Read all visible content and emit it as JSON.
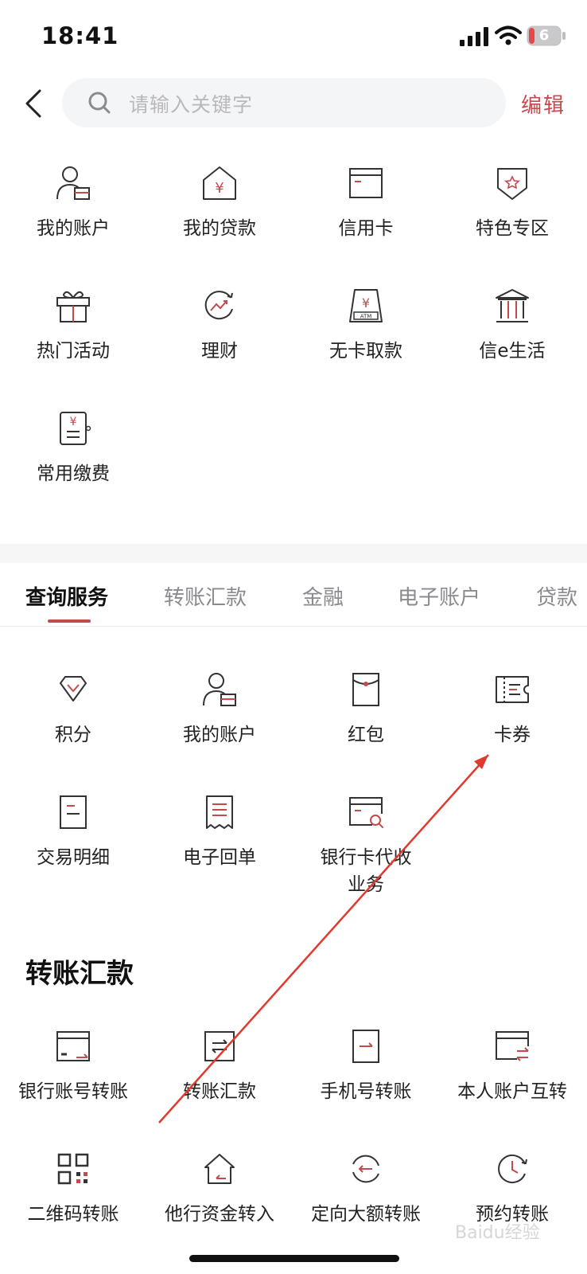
{
  "status": {
    "time": "18:41",
    "battery": "6"
  },
  "header": {
    "search_placeholder": "请输入关键字",
    "edit_label": "编辑"
  },
  "favorites": [
    {
      "label": "我的账户",
      "icon": "account-icon"
    },
    {
      "label": "我的贷款",
      "icon": "loan-icon"
    },
    {
      "label": "信用卡",
      "icon": "credit-card-icon"
    },
    {
      "label": "特色专区",
      "icon": "special-zone-icon"
    },
    {
      "label": "热门活动",
      "icon": "gift-icon"
    },
    {
      "label": "理财",
      "icon": "wealth-icon"
    },
    {
      "label": "无卡取款",
      "icon": "atm-icon"
    },
    {
      "label": "信e生活",
      "icon": "life-icon"
    },
    {
      "label": "常用缴费",
      "icon": "bill-icon"
    }
  ],
  "tabs": [
    "查询服务",
    "转账汇款",
    "金融",
    "电子账户",
    "贷款"
  ],
  "query_services": [
    {
      "label": "积分",
      "icon": "points-icon"
    },
    {
      "label": "我的账户",
      "icon": "account-icon"
    },
    {
      "label": "红包",
      "icon": "red-packet-icon"
    },
    {
      "label": "卡券",
      "icon": "coupon-icon"
    },
    {
      "label": "交易明细",
      "icon": "transaction-detail-icon"
    },
    {
      "label": "电子回单",
      "icon": "receipt-icon"
    },
    {
      "label": "银行卡代收业务",
      "icon": "card-collection-icon"
    }
  ],
  "transfer_section": {
    "title": "转账汇款",
    "items": [
      {
        "label": "银行账号转账",
        "icon": "account-transfer-icon"
      },
      {
        "label": "转账汇款",
        "icon": "remittance-icon"
      },
      {
        "label": "手机号转账",
        "icon": "phone-transfer-icon"
      },
      {
        "label": "本人账户互转",
        "icon": "self-transfer-icon"
      },
      {
        "label": "二维码转账",
        "icon": "qrcode-icon"
      },
      {
        "label": "他行资金转入",
        "icon": "inbound-transfer-icon"
      },
      {
        "label": "定向大额转账",
        "icon": "large-transfer-icon"
      },
      {
        "label": "预约转账",
        "icon": "scheduled-transfer-icon"
      }
    ]
  },
  "colors": {
    "accent": "#c44a4e",
    "annotation": "#e0392e"
  },
  "watermark": "Baidu经验"
}
